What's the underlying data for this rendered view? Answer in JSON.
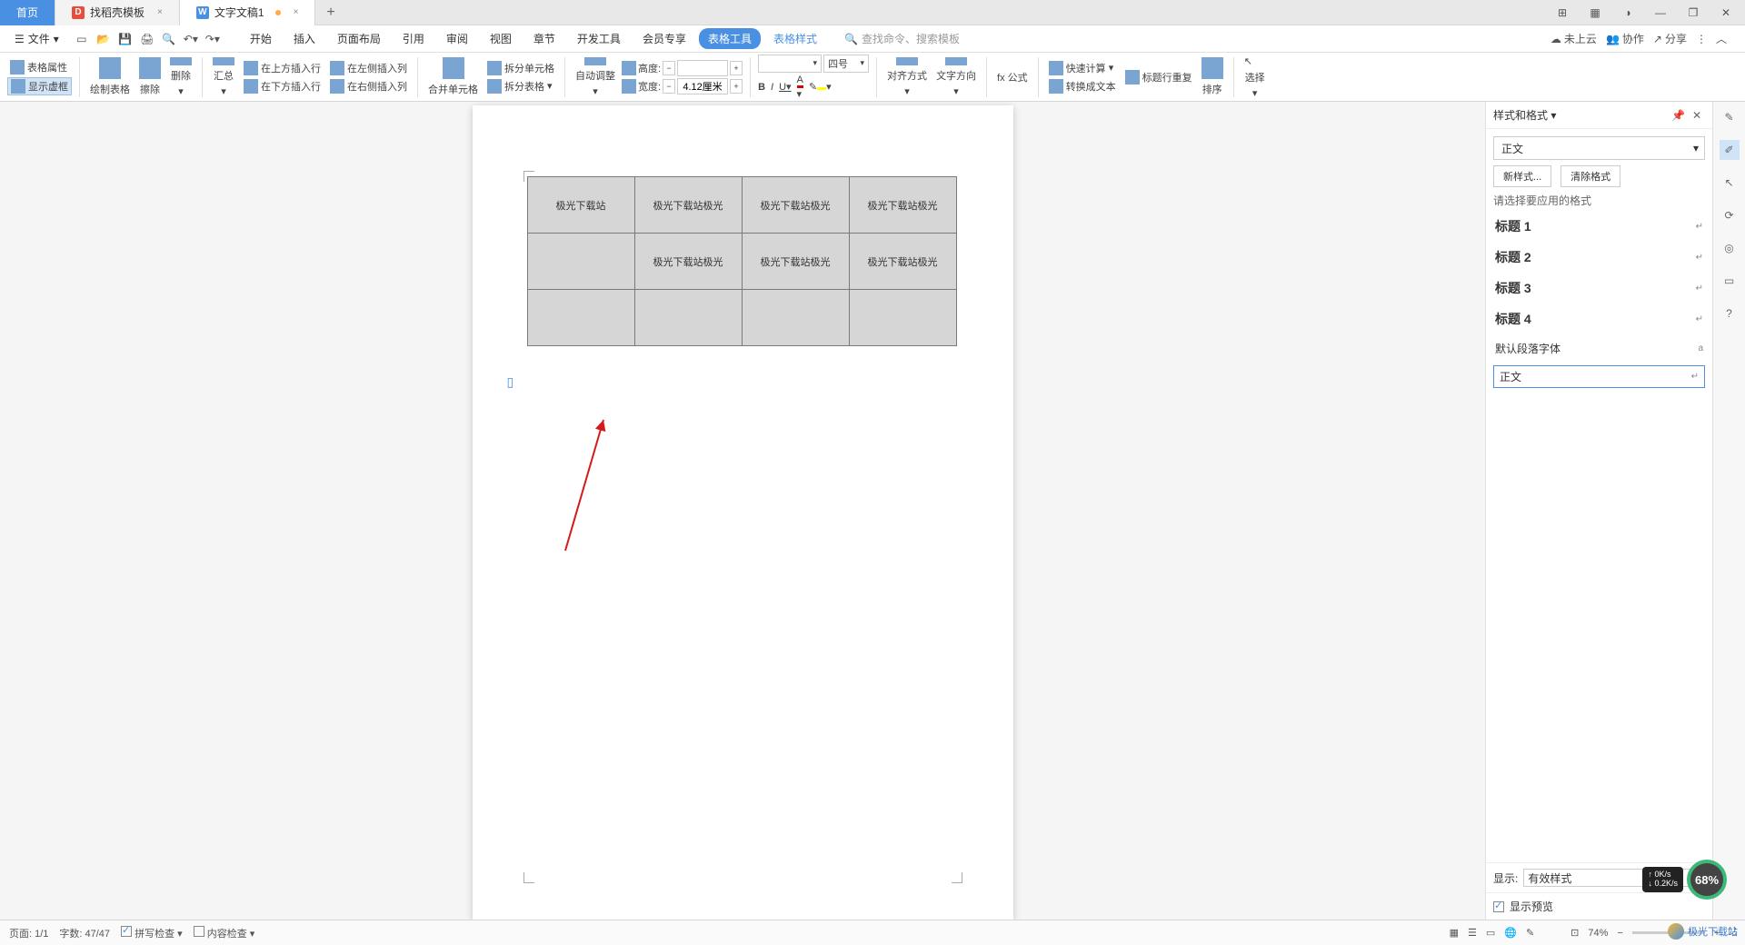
{
  "titlebar": {
    "tabs": [
      {
        "label": "首页",
        "kind": "home"
      },
      {
        "label": "找稻壳模板",
        "icon": "D",
        "iconColor": "#e84c3d"
      },
      {
        "label": "文字文稿1",
        "icon": "W",
        "iconColor": "#4a90e2",
        "modified": true
      }
    ],
    "add": "+"
  },
  "win_controls": {
    "layout": "⊞",
    "grid": "▦",
    "user": "◑",
    "min": "—",
    "max": "❐",
    "close": "✕"
  },
  "menubar": {
    "hamburger": "☰",
    "file_label": "文件",
    "file_arrow": "▾",
    "qat_tips": [
      "new-doc",
      "open",
      "save",
      "print",
      "preview",
      "undo",
      "redo"
    ],
    "tabs": [
      "开始",
      "插入",
      "页面布局",
      "引用",
      "审阅",
      "视图",
      "章节",
      "开发工具",
      "会员专享",
      "表格工具",
      "表格样式"
    ],
    "active_tab": "表格工具",
    "link_tab": "表格样式",
    "search_placeholder": "查找命令、搜索模板",
    "right": {
      "cloud": "未上云",
      "collab": "协作",
      "share": "分享"
    }
  },
  "ribbon": {
    "table_props": "表格属性",
    "show_frame": "显示虚框",
    "draw_table": "绘制表格",
    "eraser": "擦除",
    "delete": "删除",
    "summary": "汇总",
    "ins_above": "在上方插入行",
    "ins_below": "在下方插入行",
    "ins_left": "在左侧插入列",
    "ins_right": "在右侧插入列",
    "merge": "合并单元格",
    "split_cell": "拆分单元格",
    "split_table": "拆分表格",
    "auto_adjust": "自动调整",
    "height_label": "高度:",
    "height_val": "",
    "width_label": "宽度:",
    "width_val": "4.12厘米",
    "font_name": "",
    "font_size": "四号",
    "align": "对齐方式",
    "text_dir": "文字方向",
    "formula": "fx 公式",
    "fast_calc": "快速计算",
    "title_repeat": "标题行重复",
    "to_text": "转换成文本",
    "sort": "排序",
    "select": "选择"
  },
  "table_data": {
    "rows": [
      [
        "极光下载站",
        "极光下载站极光",
        "极光下载站极光",
        "极光下载站极光"
      ],
      [
        "",
        "极光下载站极光",
        "极光下载站极光",
        "极光下载站极光"
      ],
      [
        "",
        "",
        "",
        ""
      ]
    ]
  },
  "sidepanel": {
    "title": "样式和格式",
    "pin": "📌",
    "close": "✕",
    "current": "正文",
    "new_style": "新样式...",
    "clear": "清除格式",
    "prompt": "请选择要应用的格式",
    "styles": [
      "标题 1",
      "标题 2",
      "标题 3",
      "标题 4"
    ],
    "default_font": "默认段落字体",
    "selected": "正文",
    "display_label": "显示:",
    "display_value": "有效样式",
    "preview": "显示预览"
  },
  "rightbar_icons": [
    "✎",
    "✐",
    "↖",
    "⟳",
    "◎",
    "▭",
    "?"
  ],
  "statusbar": {
    "page": "页面: 1/1",
    "words": "字数: 47/47",
    "spell": "拼写检查",
    "content": "内容检查",
    "zoom": "74%",
    "fit": "⊡"
  },
  "netwidget": {
    "up": "0K/s",
    "down": "0.2K/s",
    "pct": "68%"
  },
  "watermark": "极光下载站"
}
